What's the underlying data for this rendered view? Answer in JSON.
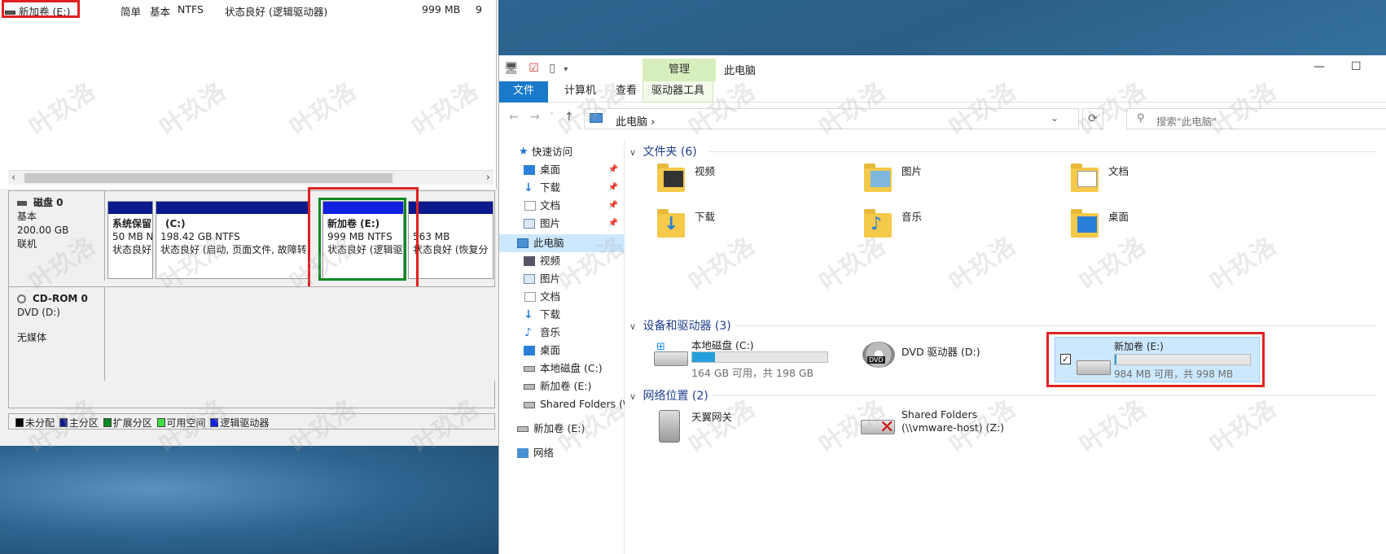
{
  "disk_mgmt": {
    "list_row": {
      "name": "新加卷 (E:)",
      "layout": "简单",
      "type": "基本",
      "fs": "NTFS",
      "status": "状态良好 (逻辑驱动器)",
      "capacity": "999 MB",
      "extra": "9"
    },
    "disk0": {
      "title": "磁盘 0",
      "type": "基本",
      "size": "200.00 GB",
      "state": "联机"
    },
    "partitions": [
      {
        "name": "系统保留",
        "size": "50 MB N",
        "status": "状态良好"
      },
      {
        "name": "(C:)",
        "size": "198.42 GB NTFS",
        "status": "状态良好 (启动, 页面文件, 故障转"
      },
      {
        "name": "新加卷  (E:)",
        "size": "999 MB NTFS",
        "status": "状态良好 (逻辑驱"
      },
      {
        "name": "",
        "size": "563 MB",
        "status": "状态良好 (恢复分"
      }
    ],
    "cdrom": {
      "title": "CD-ROM 0",
      "drive": "DVD (D:)",
      "media": "无媒体"
    },
    "legend": [
      "未分配",
      "主分区",
      "扩展分区",
      "可用空间",
      "逻辑驱动器"
    ],
    "colors": {
      "unallocated": "#000000",
      "primary": "#0a1a8c",
      "extended": "#0a8a20",
      "free": "#40e040",
      "logical": "#1020e0",
      "highlight": "#e02020"
    }
  },
  "explorer": {
    "manage_tab": "管理",
    "title": "此电脑",
    "tabs": [
      "文件",
      "计算机",
      "查看",
      "驱动器工具"
    ],
    "address": "此电脑",
    "search_placeholder": "搜索\"此电脑\"",
    "nav": {
      "quick_access": "快速访问",
      "quick_items": [
        "桌面",
        "下载",
        "文档",
        "图片"
      ],
      "this_pc": "此电脑",
      "pc_items": [
        "视频",
        "图片",
        "文档",
        "下载",
        "音乐",
        "桌面",
        "本地磁盘 (C:)",
        "新加卷 (E:)",
        "Shared Folders (\\\\"
      ],
      "new_volume": "新加卷 (E:)",
      "network": "网络"
    },
    "groups": {
      "folders": "文件夹 (6)",
      "devices": "设备和驱动器 (3)",
      "network": "网络位置 (2)"
    },
    "folders": [
      "视频",
      "图片",
      "文档",
      "下载",
      "音乐",
      "桌面"
    ],
    "drives": [
      {
        "name": "本地磁盘 (C:)",
        "free": "164 GB 可用，共 198 GB",
        "used_fraction": 0.17
      },
      {
        "name": "DVD 驱动器 (D:)"
      },
      {
        "name": "新加卷 (E:)",
        "free": "984 MB 可用，共 998 MB",
        "used_fraction": 0.015
      }
    ],
    "net_locations": [
      {
        "name": "天翼网关"
      },
      {
        "name": "Shared Folders",
        "path": "(\\\\vmware-host) (Z:)"
      }
    ]
  },
  "watermark": "叶玖洛"
}
